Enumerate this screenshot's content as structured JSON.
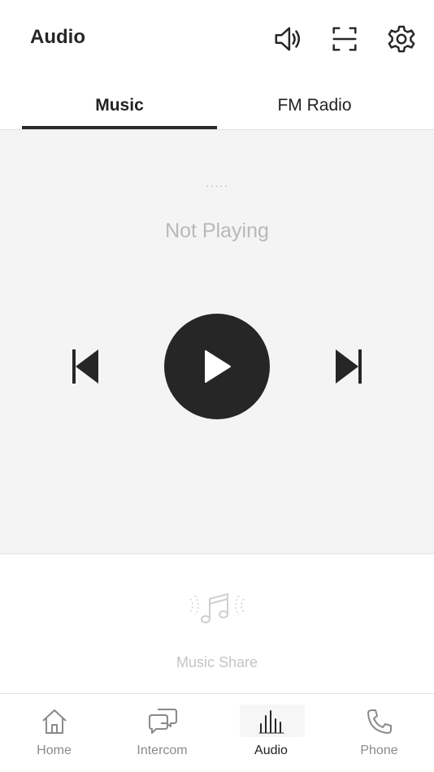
{
  "header": {
    "title": "Audio",
    "icons": [
      "speaker-volume-icon",
      "scan-icon",
      "gear-icon"
    ]
  },
  "tabs": [
    {
      "label": "Music",
      "active": true
    },
    {
      "label": "FM Radio",
      "active": false
    }
  ],
  "player": {
    "track_indicator": "·····",
    "status": "Not Playing",
    "controls": [
      "previous-track-icon",
      "play-icon",
      "next-track-icon"
    ]
  },
  "music_share": {
    "label": "Music Share",
    "icon": "music-note-icon"
  },
  "nav": [
    {
      "label": "Home",
      "icon": "home-icon",
      "active": false
    },
    {
      "label": "Intercom",
      "icon": "chat-bubbles-icon",
      "active": false
    },
    {
      "label": "Audio",
      "icon": "audio-bars-icon",
      "active": true
    },
    {
      "label": "Phone",
      "icon": "phone-icon",
      "active": false
    }
  ],
  "colors": {
    "accent": "#262626",
    "player_bg": "#f4f4f4",
    "muted_text": "#b9b9b9"
  }
}
